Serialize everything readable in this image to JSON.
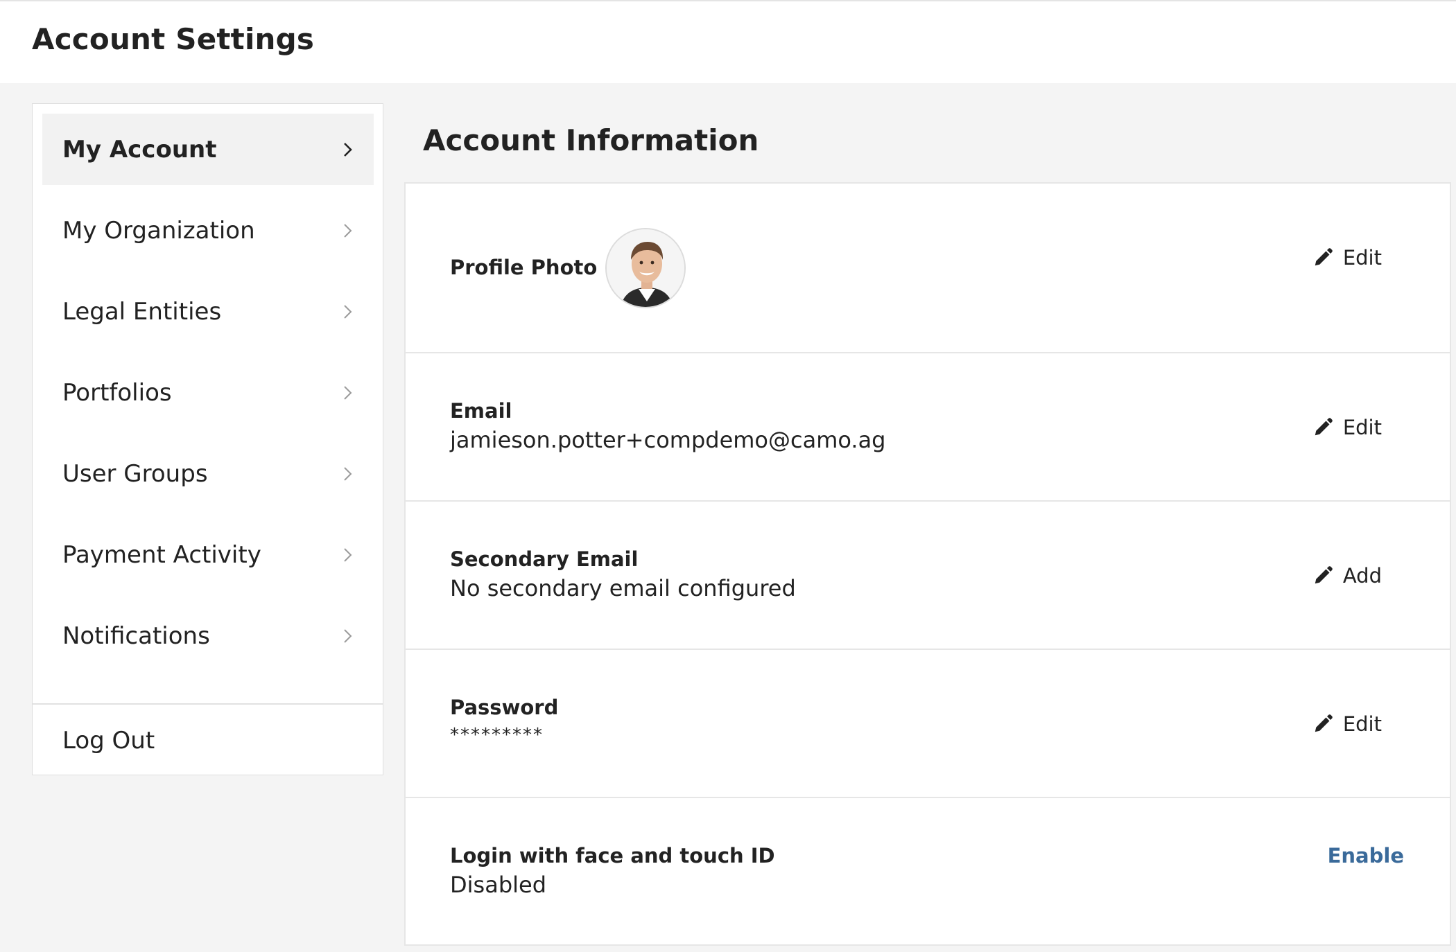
{
  "header": {
    "title": "Account Settings"
  },
  "sidebar": {
    "items": [
      {
        "label": "My Account",
        "active": true
      },
      {
        "label": "My Organization"
      },
      {
        "label": "Legal Entities"
      },
      {
        "label": "Portfolios"
      },
      {
        "label": "User Groups"
      },
      {
        "label": "Payment Activity"
      },
      {
        "label": "Notifications"
      }
    ],
    "logout_label": "Log Out"
  },
  "main": {
    "title": "Account Information",
    "rows": {
      "profile_photo": {
        "label": "Profile Photo",
        "action": "Edit"
      },
      "email": {
        "label": "Email",
        "value": "jamieson.potter+compdemo@camo.ag",
        "action": "Edit"
      },
      "secondary_email": {
        "label": "Secondary Email",
        "value": "No secondary email configured",
        "action": "Add"
      },
      "password": {
        "label": "Password",
        "value": "*********",
        "action": "Edit"
      },
      "face_id": {
        "label": "Login with face and touch ID",
        "value": "Disabled",
        "action": "Enable"
      }
    }
  },
  "colors": {
    "accent_link": "#3a6a9a",
    "background": "#f4f4f4",
    "card": "#ffffff"
  },
  "icons": {
    "nav_chevron": "chevron-right-icon",
    "edit": "pencil-icon"
  }
}
